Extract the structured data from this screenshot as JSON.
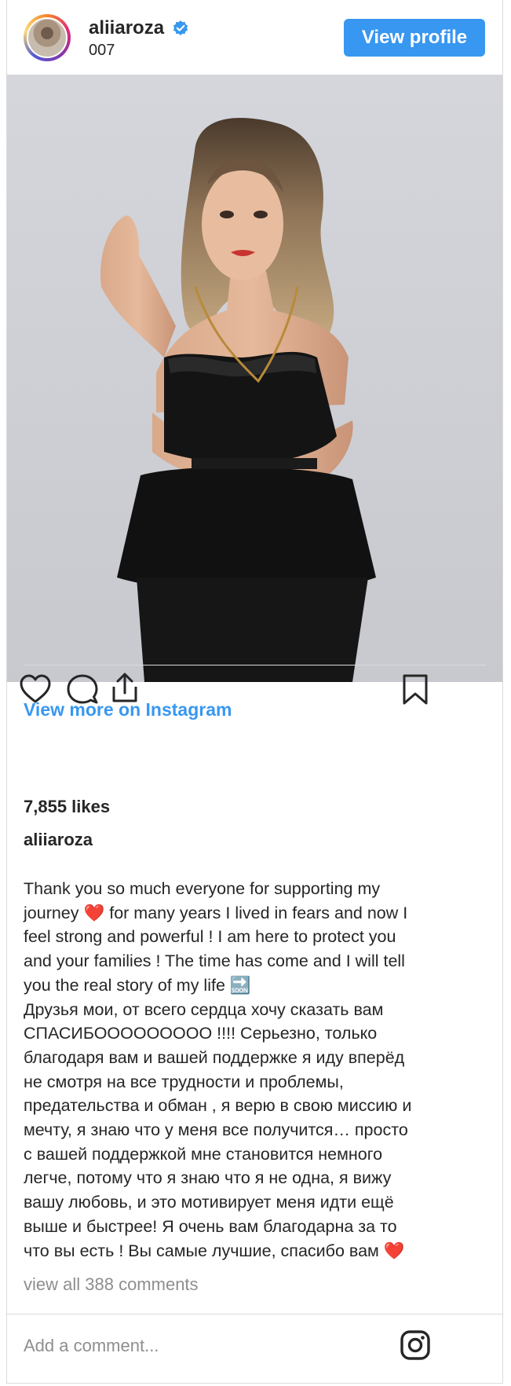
{
  "header": {
    "username": "aliiaroza",
    "subtitle": "007",
    "verified": true,
    "view_profile_label": "View profile"
  },
  "post": {
    "image_description_alt": "",
    "view_more_label": "View more on Instagram",
    "likes_text": "7,855 likes",
    "caption_username": "aliiaroza",
    "caption_text": "Thank you so much everyone for supporting my\njourney ❤️ for many years I lived in fears and now I\nfeel strong and powerful ! I am here to protect you\nand your families ! The time has come and I will tell\nyou the real story of my life 🔜\nДрузья мои, от всего сердца хочу сказать вам\nСПАСИБООООООООО !!!! Серьезно, только\nблагодаря вам и вашей поддержке я иду вперёд\nне смотря на все трудности и проблемы,\nпредательства и обман , я верю в свою миссию и\nмечту, я знаю что у меня все получится… просто\nс вашей поддержкой мне становится немного\nлегче, потому что я знаю что я не одна, я вижу\nвашу любовь, и это мотивирует меня идти ещё\nвыше и быстрее! Я очень вам благодарна за то\nчто вы есть ! Вы самые лучшие, спасибо вам ❤️",
    "view_comments_label": "view all 388 comments",
    "comment_placeholder": "Add a comment..."
  },
  "icons": {
    "verified": "verified-badge-icon",
    "like": "heart-icon",
    "comment": "comment-bubble-icon",
    "share": "share-icon",
    "save": "bookmark-icon",
    "instagram": "instagram-logo-icon"
  },
  "colors": {
    "accent": "#3897f0",
    "text": "#262626",
    "muted": "#8e8e8e",
    "border": "#dbdbdb"
  }
}
